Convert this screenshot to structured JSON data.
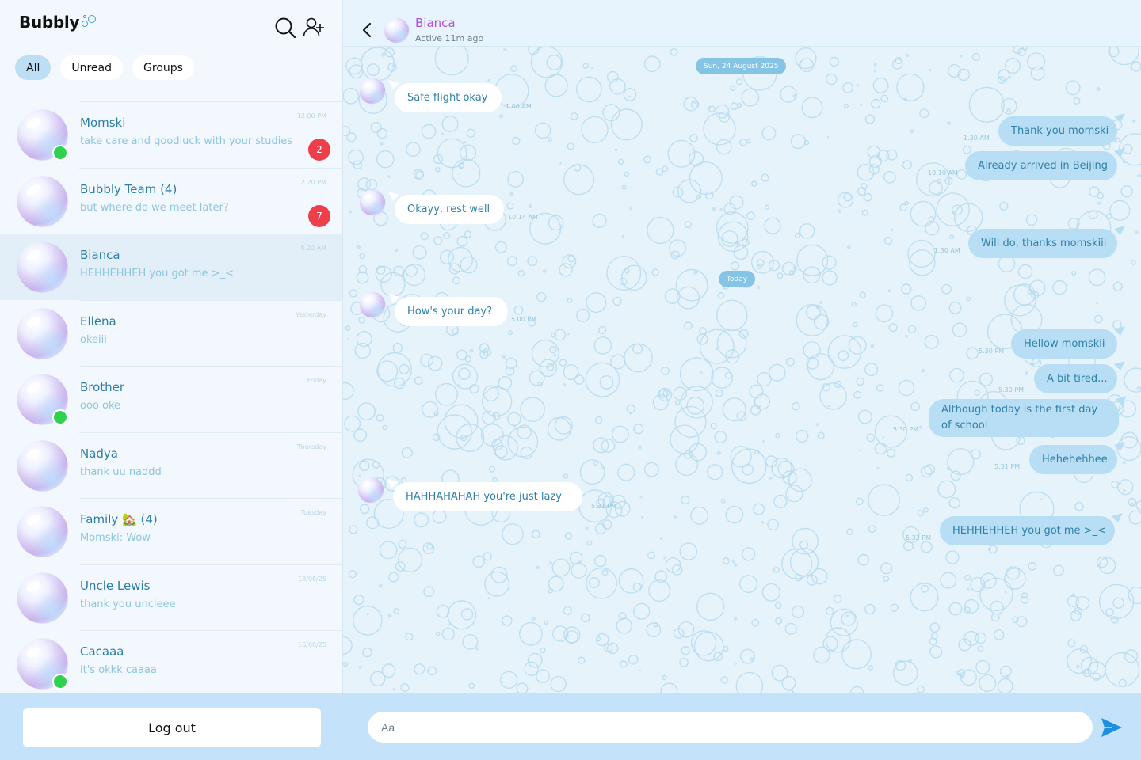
{
  "brand": {
    "name": "Bubbly"
  },
  "filters": [
    "All",
    "Unread",
    "Groups"
  ],
  "chats": [
    {
      "name": "Momski",
      "preview": "take care and goodluck with your studies",
      "time": "12.00 PM",
      "badge": "2",
      "online": true
    },
    {
      "name": "Bubbly Team (4)",
      "preview": "but where do we meet later?",
      "time": "2.20 PM",
      "badge": "7",
      "online": false
    },
    {
      "name": "Bianca",
      "preview": "HEHHEHHEH you got me >_<",
      "time": "8.20 AM",
      "badge": "",
      "online": false,
      "active": true
    },
    {
      "name": "Ellena",
      "preview": "okeiii",
      "time": "Yesterday",
      "badge": "",
      "online": false
    },
    {
      "name": "Brother",
      "preview": "ooo oke",
      "time": "Friday",
      "badge": "",
      "online": true
    },
    {
      "name": "Nadya",
      "preview": "thank uu naddd",
      "time": "Thursday",
      "badge": "",
      "online": false
    },
    {
      "name": "Family 🏡 (4)",
      "preview": "Momski: Wow",
      "time": "Tuesday",
      "badge": "",
      "online": false
    },
    {
      "name": "Uncle Lewis",
      "preview": "thank you uncleee",
      "time": "18/08/25",
      "badge": "",
      "online": false
    },
    {
      "name": "Cacaaa",
      "preview": "it's okkk caaaa",
      "time": "16/08/25",
      "badge": "",
      "online": true
    }
  ],
  "sidebar": {
    "logout_label": "Log out"
  },
  "conversation": {
    "name": "Bianca",
    "status": "Active 11m ago",
    "date_separators": [
      "Sun, 24 August 2025",
      "Today"
    ],
    "messages": [
      {
        "dir": "in",
        "text": "Safe flight okay",
        "time": "1.00 AM"
      },
      {
        "dir": "out",
        "text": "Thank you momski",
        "time": "1.30 AM"
      },
      {
        "dir": "out",
        "text": "Already arrived in Beijing",
        "time": "10.10 AM"
      },
      {
        "dir": "in",
        "text": "Okayy, rest well",
        "time": "10.14 AM"
      },
      {
        "dir": "out",
        "text": "Will do, thanks momskiii",
        "time": "1.30 AM"
      },
      {
        "dir": "in",
        "text": "How's your day?",
        "time": "5.00 PM"
      },
      {
        "dir": "out",
        "text": "Hellow momskii",
        "time": "5.30 PM"
      },
      {
        "dir": "out",
        "text": "A bit tired...",
        "time": "5.30 PM"
      },
      {
        "dir": "out",
        "text": "Although today is the first day of school",
        "time": "5.30 PM"
      },
      {
        "dir": "out",
        "text": "Hehehehhee",
        "time": "5.31 PM"
      },
      {
        "dir": "in",
        "text": "HAHHAHAHAH you're just lazy",
        "time": "5.31 PM"
      },
      {
        "dir": "out",
        "text": "HEHHEHHEH you got me >_<",
        "time": "5.32 PM"
      }
    ]
  },
  "composer": {
    "placeholder": "Aa"
  },
  "colors": {
    "accent": "#85c4e5",
    "outgoing_bubble": "#b7def5",
    "badge": "#ef3e4a",
    "online": "#2fd24f",
    "contact_name": "#b352d6"
  },
  "icons": [
    "bubbles-logo-icon",
    "search-icon",
    "add-user-icon",
    "back-arrow-icon",
    "send-icon"
  ]
}
